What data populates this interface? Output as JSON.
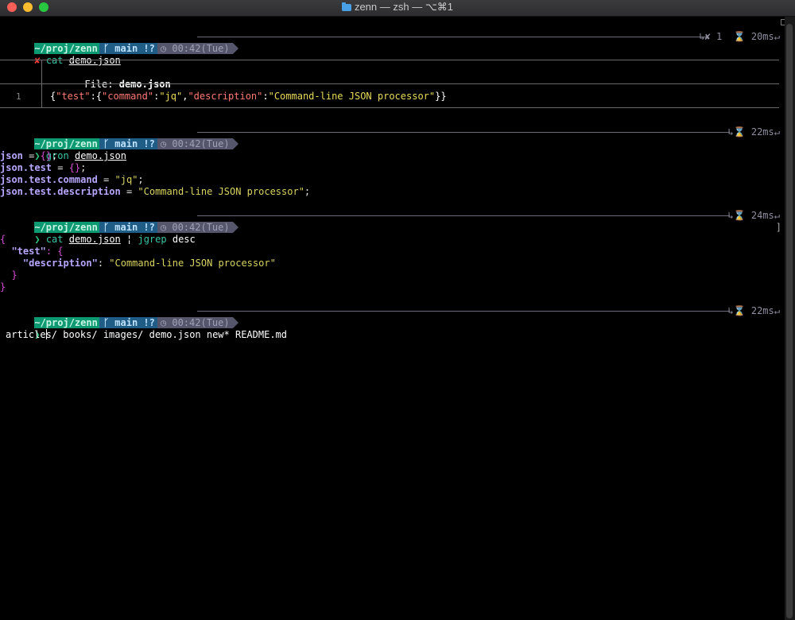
{
  "window": {
    "title": "zenn — zsh — ⌥⌘1"
  },
  "prompt": {
    "dir": "~/proj/zenn",
    "branch_icon": "ᚴ",
    "branch": "main",
    "status": "!?",
    "clock_icon": "◷",
    "time": "00:42(Tue)",
    "hourglass_icon": "⌛"
  },
  "blocks": [
    {
      "status_symbol": "✘",
      "command": "cat",
      "argument": "demo.json",
      "right_prefix": "↳✘ 1",
      "duration": "20ms",
      "return_symbol": "↵"
    },
    {
      "status_symbol": "❯",
      "command": "gron",
      "argument": "demo.json",
      "right_prefix": "↳",
      "duration": "22ms",
      "return_symbol": "↵"
    },
    {
      "status_symbol": "❯",
      "command": "cat",
      "argument": "demo.json",
      "pipe": "¦",
      "command2": "jgrep",
      "argument2": "desc",
      "right_prefix": "↳",
      "duration": "24ms",
      "return_symbol": "↵"
    },
    {
      "status_symbol": "❯",
      "right_prefix": "↳",
      "duration": "22ms",
      "return_symbol": "↵"
    }
  ],
  "bat": {
    "file_label": "File:",
    "file_name": "demo.json",
    "line_number": "1",
    "content": {
      "open": "{",
      "k1": "\"test\"",
      "colon1": ":{",
      "k2": "\"command\"",
      "colon2": ":",
      "v2": "\"jq\"",
      "comma": ",",
      "k3": "\"description\"",
      "colon3": ":",
      "v3": "\"Command-line JSON processor\"",
      "close": "}}"
    }
  },
  "gron_output": [
    {
      "path": "json",
      "eq": " = ",
      "val": "{}",
      "end": ";"
    },
    {
      "path": "json.test",
      "eq": " = ",
      "val": "{}",
      "end": ";"
    },
    {
      "path": "json.test.command",
      "eq": " = ",
      "val": "\"jq\"",
      "end": ";"
    },
    {
      "path": "json.test.description",
      "eq": " = ",
      "val": "\"Command-line JSON processor\"",
      "end": ";"
    }
  ],
  "jgrep_output": {
    "l1": "{",
    "l2_key": "\"test\"",
    "l2_rest": ": {",
    "l3_key": "\"description\"",
    "l3_colon": ": ",
    "l3_val": "\"Command-line JSON processor\"",
    "l4": "}",
    "l5": "}"
  },
  "completion_list": "articles/ books/ images/ demo.json new* README.md",
  "scroll_marker": "]"
}
